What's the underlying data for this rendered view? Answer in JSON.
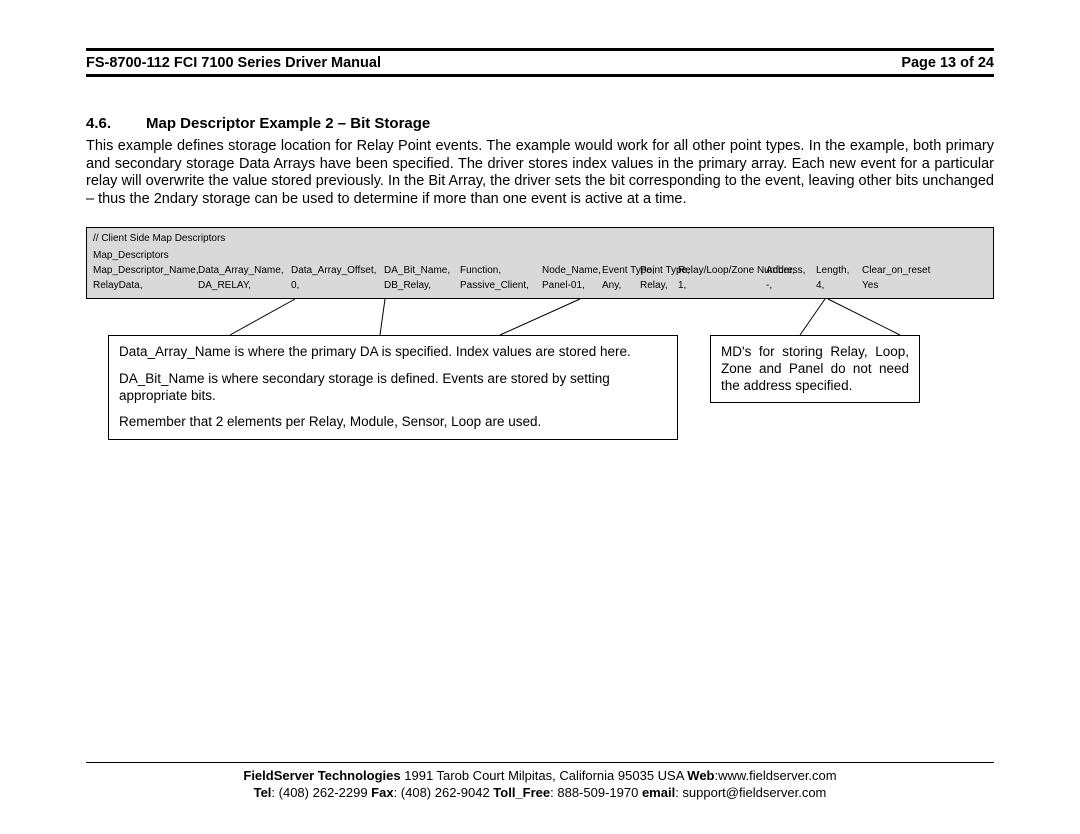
{
  "header": {
    "title": "FS-8700-112 FCI 7100 Series Driver Manual",
    "page": "Page 13 of 24"
  },
  "section": {
    "number": "4.6.",
    "title": "Map Descriptor Example 2 – Bit Storage",
    "paragraph": "This example defines storage location for Relay Point events. The example would work for all other point types. In the example, both primary and secondary storage Data Arrays have been specified. The driver stores index values in the primary array. Each new event for a particular relay will overwrite the value stored previously. In the Bit Array, the driver sets the bit corresponding to the event, leaving other bits unchanged – thus the 2ndary storage can be used to determine if more than one event is active at a time."
  },
  "table": {
    "comment": "//     Client Side Map Descriptors",
    "label": "Map_Descriptors",
    "headers": {
      "c1": "Map_Descriptor_Name,",
      "c2": "Data_Array_Name,",
      "c3": "Data_Array_Offset,",
      "c4": "DA_Bit_Name,",
      "c5": "Function,",
      "c6": "Node_Name,",
      "c7": "Event Type,",
      "c8": "Point Type,",
      "c9": "Relay/Loop/Zone Number,",
      "c10": "Address,",
      "c11": "Length,",
      "c12": "Clear_on_reset"
    },
    "row": {
      "c1": "RelayData,",
      "c2": "DA_RELAY,",
      "c3": "0,",
      "c4": "DB_Relay,",
      "c5": "Passive_Client,",
      "c6": "Panel-01,",
      "c7": "Any,",
      "c8": "Relay,",
      "c9": "1,",
      "c10": "-,",
      "c11": "4,",
      "c12": "Yes"
    }
  },
  "callouts": {
    "left": {
      "p1": "Data_Array_Name is where the primary DA is specified.  Index values are stored here.",
      "p2": "DA_Bit_Name is where secondary storage is defined. Events are stored by setting appropriate bits.",
      "p3": "Remember that 2 elements per Relay, Module, Sensor, Loop are used."
    },
    "right": "MD's for storing Relay, Loop, Zone and Panel do not need the address specified."
  },
  "footer": {
    "line1_company": "FieldServer Technologies",
    "line1_addr": " 1991 Tarob Court Milpitas, California 95035 USA  ",
    "line1_web_label": "Web",
    "line1_web": ":www.fieldserver.com",
    "line2_tel_label": "Tel",
    "line2_tel": ": (408) 262-2299  ",
    "line2_fax_label": "Fax",
    "line2_fax": ": (408) 262-9042  ",
    "line2_toll_label": "Toll_Free",
    "line2_toll": ": 888-509-1970   ",
    "line2_email_label": "email",
    "line2_email": ": support@fieldserver.com"
  }
}
